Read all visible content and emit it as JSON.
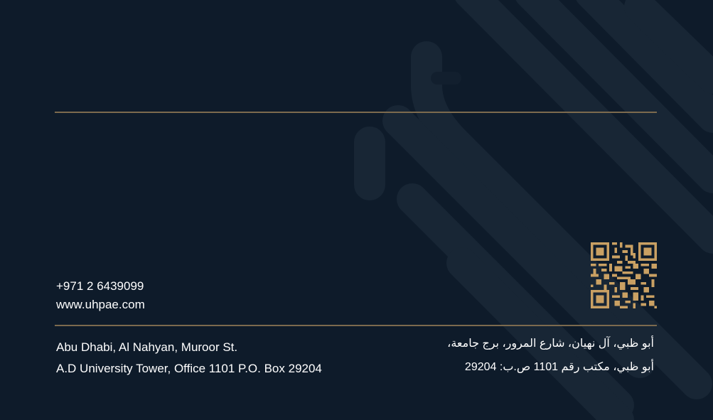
{
  "contact": {
    "phone": "+971 2 6439099",
    "website": "www.uhpae.com"
  },
  "address_en": {
    "line1": "Abu Dhabi, Al Nahyan, Muroor St.",
    "line2": "A.D University Tower, Office 1101 P.O. Box 29204"
  },
  "address_ar": {
    "line1": "أبو ظبي، آل نهيان، شارع المرور، برج جامعة،",
    "line2": "أبو ظبي، مكتب رقم 1101 ص.ب: 29204"
  },
  "colors": {
    "background": "#0e1b2a",
    "accent_gold": "#c9a063",
    "rule": "#7c6a4e",
    "pattern": "#1b2836"
  },
  "icons": [
    "qr-code-icon"
  ]
}
